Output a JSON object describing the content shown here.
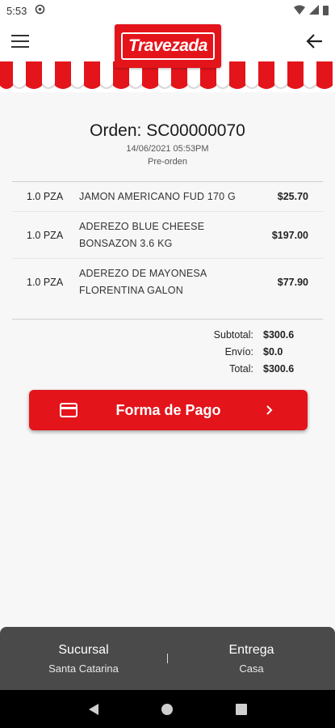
{
  "status_bar": {
    "time": "5:53"
  },
  "header": {
    "logo_text": "Travezada",
    "brand_color": "#e4141b"
  },
  "order": {
    "title": "Orden: SC00000070",
    "date": "14/06/2021 05:53PM",
    "status": "Pre-orden"
  },
  "items": [
    {
      "qty": "1.0 PZA",
      "name": "JAMON AMERICANO FUD 170 G",
      "price": "$25.70"
    },
    {
      "qty": "1.0 PZA",
      "name": "ADEREZO BLUE CHEESE BONSAZON 3.6 KG",
      "price": "$197.00"
    },
    {
      "qty": "1.0 PZA",
      "name": "ADEREZO DE MAYONESA FLORENTINA GALON",
      "price": "$77.90"
    }
  ],
  "totals": {
    "subtotal_label": "Subtotal:",
    "subtotal": "$300.6",
    "shipping_label": "Envío:",
    "shipping": "$0.0",
    "total_label": "Total:",
    "total": "$300.6"
  },
  "payment_button": {
    "label": "Forma de Pago"
  },
  "bottom_bar": {
    "branch_title": "Sucursal",
    "branch_value": "Santa Catarina",
    "delivery_title": "Entrega",
    "delivery_value": "Casa"
  },
  "icons": [
    "menu-icon",
    "back-arrow-icon",
    "credit-card-icon",
    "chevron-right-icon",
    "wifi-icon",
    "signal-icon",
    "battery-icon"
  ]
}
